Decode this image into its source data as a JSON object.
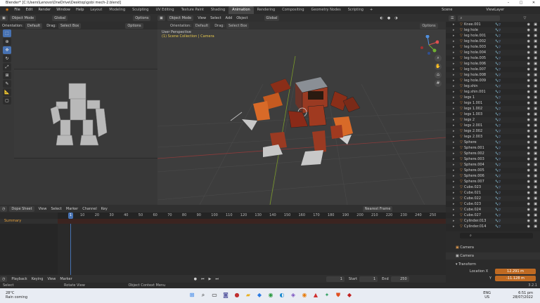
{
  "window": {
    "title": "Blender* [C:\\Users\\Lenovo\\OneDrive\\Desktop\\gobi mech-2.blend]"
  },
  "menu": {
    "items": [
      "File",
      "Edit",
      "Render",
      "Window",
      "Help"
    ],
    "workspaces": [
      "Layout",
      "Modeling",
      "Sculpting",
      "UV Editing",
      "Texture Paint",
      "Shading",
      "Animation",
      "Rendering",
      "Compositing",
      "Geometry Nodes",
      "Scripting"
    ],
    "scene": "Scene",
    "view_layer": "ViewLayer"
  },
  "left_view": {
    "mode": "Object Mode",
    "orientation_label": "Orientation:",
    "orientation": "Default",
    "drag_label": "Drag:",
    "drag": "Select Box",
    "options": "Options",
    "global": "Global"
  },
  "right_view": {
    "mode": "Object Mode",
    "view": "View",
    "select": "Select",
    "add": "Add",
    "object": "Object",
    "global": "Global",
    "orientation_label": "Orientation:",
    "orientation": "Default",
    "drag_label": "Drag:",
    "drag": "Select Box",
    "options": "Options",
    "info_line1": "User Perspective",
    "info_line2": "(1) Scene Collection | Camera"
  },
  "outliner": {
    "rows": [
      "Knee.001",
      "leg hole",
      "leg hole.001",
      "leg hole.002",
      "leg hole.003",
      "leg hole.004",
      "leg hole.005",
      "leg hole.006",
      "leg hole.007",
      "leg hole.008",
      "leg hole.009",
      "leg.shin",
      "leg.shin.001",
      "legs 1",
      "legs 1.001",
      "legs 1.002",
      "legs 1.003",
      "legs 2",
      "legs 2.001",
      "legs 2.002",
      "legs 2.003",
      "Sphere",
      "Sphere.001",
      "Sphere.002",
      "Sphere.003",
      "Sphere.004",
      "Sphere.005",
      "Sphere.006",
      "Sphere.007",
      "Cube.023",
      "Cube.021",
      "Cube.022",
      "Cube.023",
      "Cube.024",
      "Cube.027",
      "Cylinder.013",
      "Cylinder.014"
    ]
  },
  "properties": {
    "object_name": "Camera",
    "data_name": "Camera",
    "section": "Transform",
    "location_x_label": "Location X",
    "location_x": "12.291 m",
    "location_y_label": "Y",
    "location_y": "-11.128 m"
  },
  "dopesheet": {
    "editor": "Dope Sheet",
    "view": "View",
    "select": "Select",
    "marker": "Marker",
    "channel": "Channel",
    "key": "Key",
    "keying_type": "Nearest Frame",
    "summary": "Summary",
    "current_frame": "1",
    "ticks": [
      "10",
      "20",
      "30",
      "40",
      "50",
      "60",
      "70",
      "80",
      "90",
      "100",
      "110",
      "120",
      "130",
      "140",
      "150",
      "160",
      "170",
      "180",
      "190",
      "200",
      "210",
      "220",
      "230",
      "240",
      "250"
    ],
    "playback": "Playback",
    "keying": "Keying",
    "pb_view": "View",
    "pb_marker": "Marker",
    "frame_field": "1",
    "start_label": "Start",
    "start": "1",
    "end_label": "End",
    "end": "250"
  },
  "status": {
    "select": "Select",
    "rotate": "Rotate View",
    "context": "Object Context Menu",
    "version": "3.2.1"
  },
  "taskbar": {
    "temperature": "28°C",
    "weather": "Rain coming",
    "lang1": "ENG",
    "lang2": "US",
    "time": "6:51 pm",
    "date": "28/07/2022"
  }
}
